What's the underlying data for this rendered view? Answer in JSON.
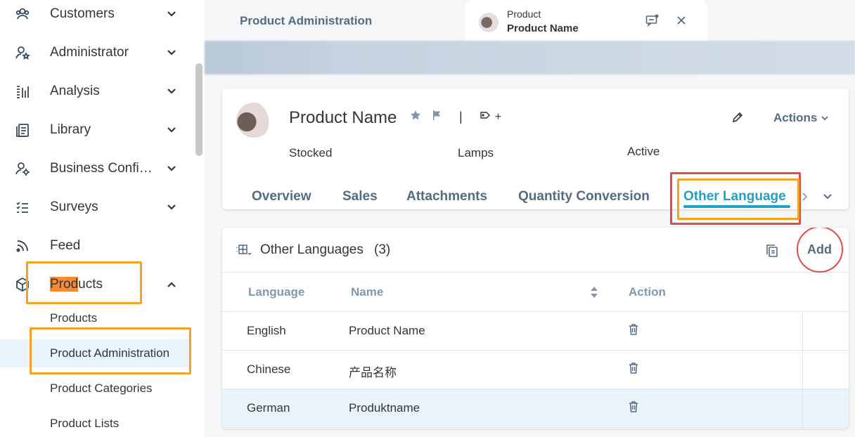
{
  "sidebar": {
    "items": [
      {
        "label": "Customers",
        "icon": "customers-icon"
      },
      {
        "label": "Administrator",
        "icon": "administrator-icon"
      },
      {
        "label": "Analysis",
        "icon": "analysis-icon"
      },
      {
        "label": "Library",
        "icon": "library-icon"
      },
      {
        "label": "Business Confi…",
        "icon": "business-config-icon"
      },
      {
        "label": "Surveys",
        "icon": "surveys-icon"
      },
      {
        "label": "Feed",
        "icon": "feed-icon"
      }
    ],
    "products": {
      "label_highlight": "Prod",
      "label_rest": "ucts",
      "icon": "products-icon"
    },
    "sub_items": [
      "Products",
      "Product Administration",
      "Product Categories",
      "Product Lists"
    ]
  },
  "tabbar": {
    "app_tab": "Product Administration",
    "doc_tab": {
      "line1": "Product",
      "line2": "Product Name"
    }
  },
  "object": {
    "title": "Product Name",
    "separator": "|",
    "tag_plus": "+",
    "actions": "Actions",
    "attributes": [
      "Stocked",
      "Lamps",
      "Active"
    ],
    "tabs": [
      "Overview",
      "Sales",
      "Attachments",
      "Quantity Conversion",
      "Other Language"
    ],
    "active_tab": "Other Language"
  },
  "table": {
    "title": "Other Languages",
    "count": "(3)",
    "add": "Add",
    "columns": [
      "Language",
      "Name",
      "Action"
    ],
    "rows": [
      {
        "language": "English",
        "name": "Product Name"
      },
      {
        "language": "Chinese",
        "name": "产品名称"
      },
      {
        "language": "German",
        "name": "Produktname"
      }
    ]
  },
  "colors": {
    "accent": "#23a0c5",
    "highlight": "#f2a325",
    "annotation_red": "#e04b4b",
    "selected_row": "#e8f4f8"
  }
}
